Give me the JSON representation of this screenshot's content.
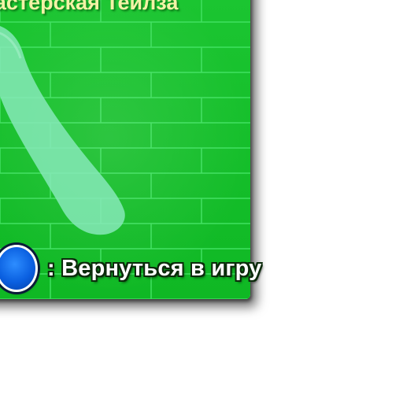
{
  "screen": {
    "title": "Мастерская Тейлза",
    "back_hint": {
      "separator": ":",
      "label": "Вернуться в игру",
      "button_icon": "blue-circle-button-icon"
    }
  },
  "colors": {
    "panel_green": "#12c02a",
    "brick_line": "#39e05a",
    "silhouette": "#7fe6b0",
    "title_text": "#f3f2a6",
    "button_blue": "#0a5fe0"
  }
}
